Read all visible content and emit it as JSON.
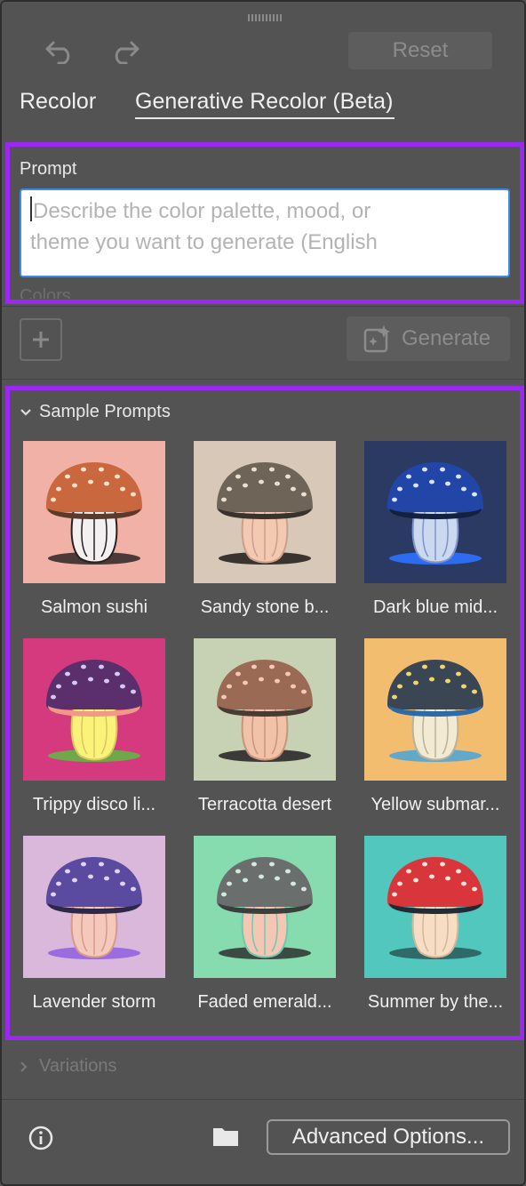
{
  "toolbar": {
    "reset_label": "Reset"
  },
  "tabs": [
    {
      "label": "Recolor",
      "active": false
    },
    {
      "label": "Generative Recolor (Beta)",
      "active": true
    }
  ],
  "prompt": {
    "label": "Prompt",
    "placeholder_line1": "Describe the color palette, mood, or",
    "placeholder_line2": "theme you want to generate (English"
  },
  "colors": {
    "label": "Colors"
  },
  "generate": {
    "label": "Generate"
  },
  "sample_prompts": {
    "header": "Sample Prompts",
    "items": [
      {
        "label": "Salmon sushi",
        "bg": "#f2b1a6",
        "cap": "#c9683e",
        "rim": "#5a3a2a",
        "dots": "#ffe2c8",
        "stem": "#f4f0f2",
        "stemLine": "#2a2020",
        "shadow": "#4a3a38"
      },
      {
        "label": "Sandy stone b...",
        "bg": "#d7c8b8",
        "cap": "#6f6458",
        "rim": "#3a322c",
        "dots": "#e9dfcf",
        "stem": "#f3c9b2",
        "stemLine": "#c9a08c",
        "shadow": "#3a342e"
      },
      {
        "label": "Dark blue mid...",
        "bg": "#2b3a63",
        "cap": "#2245a8",
        "rim": "#142040",
        "dots": "#d8e4ff",
        "stem": "#cbd8f0",
        "stemLine": "#7f95c6",
        "shadow": "#2d6cf0"
      },
      {
        "label": "Trippy disco li...",
        "bg": "#d63a7e",
        "cap": "#5a2f6c",
        "rim": "#ef9a86",
        "dots": "#d8c7f2",
        "stem": "#fbf27a",
        "stemLine": "#d9c65c",
        "shadow": "#6ea84a"
      },
      {
        "label": "Terracotta desert",
        "bg": "#c7d2b4",
        "cap": "#9a6a55",
        "rim": "#4a3a34",
        "dots": "#f1c9b6",
        "stem": "#f2c2a8",
        "stemLine": "#c8957c",
        "shadow": "#3c3a36"
      },
      {
        "label": "Yellow submar...",
        "bg": "#f2bd6e",
        "cap": "#3a4654",
        "rim": "#2d6aa8",
        "dots": "#f3d66a",
        "stem": "#f2ead2",
        "stemLine": "#b7b39a",
        "shadow": "#62a8c9"
      },
      {
        "label": "Lavender storm",
        "bg": "#d9b8dc",
        "cap": "#5b4ba0",
        "rim": "#2e2848",
        "dots": "#e2d2f2",
        "stem": "#f4c9bc",
        "stemLine": "#d49a8c",
        "shadow": "#9b6be0"
      },
      {
        "label": "Faded emerald...",
        "bg": "#86dcae",
        "cap": "#6a6f6e",
        "rim": "#3a3f3e",
        "dots": "#d4e8dc",
        "stem": "#f4c6b4",
        "stemLine": "#6fc9b0",
        "shadow": "#3c4a44"
      },
      {
        "label": "Summer by the...",
        "bg": "#52c7bd",
        "cap": "#d8363a",
        "rim": "#222a34",
        "dots": "#f6e3d8",
        "stem": "#f6ddc4",
        "stemLine": "#d2b79a",
        "shadow": "#2f6a68"
      }
    ]
  },
  "variations": {
    "label": "Variations"
  },
  "footer": {
    "advanced_label": "Advanced Options..."
  },
  "colors_theme": {
    "highlight": "#9b27f2",
    "focus": "#3d8be8"
  }
}
